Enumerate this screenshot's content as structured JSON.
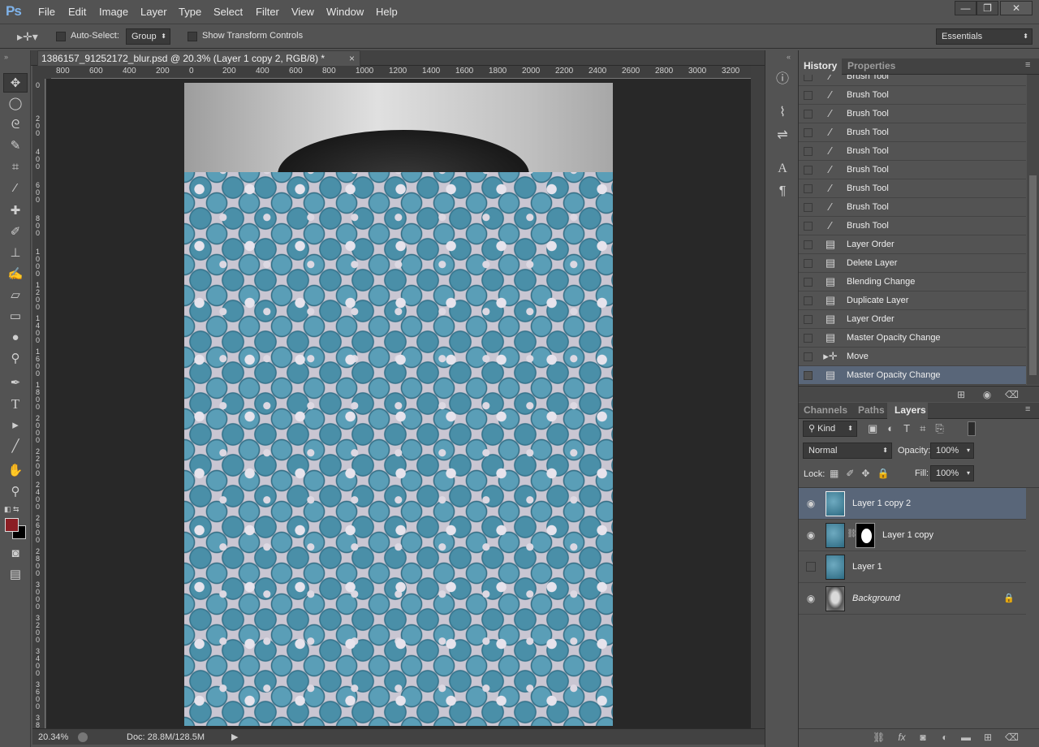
{
  "app": {
    "logo": "Ps"
  },
  "menu": [
    "File",
    "Edit",
    "Image",
    "Layer",
    "Type",
    "Select",
    "Filter",
    "View",
    "Window",
    "Help"
  ],
  "window_controls": {
    "minimize": "—",
    "restore": "❐",
    "close": "✕"
  },
  "options_bar": {
    "auto_select_label": "Auto-Select:",
    "auto_select_value": "Group",
    "transform_controls_label": "Show Transform Controls",
    "workspace": "Essentials"
  },
  "document": {
    "tab_title": "1386157_91252172_blur.psd @ 20.3% (Layer 1 copy 2, RGB/8) *",
    "close": "×"
  },
  "ruler_h": [
    "800",
    "600",
    "400",
    "200",
    "0",
    "200",
    "400",
    "600",
    "800",
    "1000",
    "1200",
    "1400",
    "1600",
    "1800",
    "2000",
    "2200",
    "2400",
    "2600",
    "2800",
    "3000",
    "3200"
  ],
  "ruler_v": [
    "0",
    "2\n0\n0",
    "4\n0\n0",
    "6\n0\n0",
    "8\n0\n0",
    "1\n0\n0\n0",
    "1\n2\n0\n0",
    "1\n4\n0\n0",
    "1\n6\n0\n0",
    "1\n8\n0\n0",
    "2\n0\n0\n0",
    "2\n2\n0\n0",
    "2\n4\n0\n0",
    "2\n6\n0\n0",
    "2\n8\n0\n0",
    "3\n0\n0\n0",
    "3\n2\n0\n0",
    "3\n4\n0\n0",
    "3\n6\n0\n0",
    "3\n8"
  ],
  "status": {
    "zoom": "20.34%",
    "doc": "Doc: 28.8M/128.5M"
  },
  "colors": {
    "foreground": "#8b1e24",
    "background": "#000000",
    "selection": "#596679"
  },
  "history_panel": {
    "tabs": [
      "History",
      "Properties"
    ],
    "items": [
      {
        "label": "Brush Tool",
        "icon": "brush-icon"
      },
      {
        "label": "Brush Tool",
        "icon": "brush-icon"
      },
      {
        "label": "Brush Tool",
        "icon": "brush-icon"
      },
      {
        "label": "Brush Tool",
        "icon": "brush-icon"
      },
      {
        "label": "Brush Tool",
        "icon": "brush-icon"
      },
      {
        "label": "Brush Tool",
        "icon": "brush-icon"
      },
      {
        "label": "Brush Tool",
        "icon": "brush-icon"
      },
      {
        "label": "Brush Tool",
        "icon": "brush-icon"
      },
      {
        "label": "Brush Tool",
        "icon": "brush-icon"
      },
      {
        "label": "Layer Order",
        "icon": "document-icon"
      },
      {
        "label": "Delete Layer",
        "icon": "document-icon"
      },
      {
        "label": "Blending Change",
        "icon": "document-icon"
      },
      {
        "label": "Duplicate Layer",
        "icon": "document-icon"
      },
      {
        "label": "Layer Order",
        "icon": "document-icon"
      },
      {
        "label": "Master Opacity Change",
        "icon": "document-icon"
      },
      {
        "label": "Move",
        "icon": "move-icon"
      },
      {
        "label": "Master Opacity Change",
        "icon": "document-icon"
      }
    ],
    "selected_index": 16
  },
  "layers_panel": {
    "tabs": [
      "Channels",
      "Paths",
      "Layers"
    ],
    "filter_kind": "Kind",
    "blend_mode": "Normal",
    "opacity_label": "Opacity:",
    "opacity": "100%",
    "lock_label": "Lock:",
    "fill_label": "Fill:",
    "fill": "100%",
    "layers": [
      {
        "name": "Layer 1 copy 2",
        "visible": true,
        "selected": true,
        "mask": false
      },
      {
        "name": "Layer 1 copy",
        "visible": true,
        "selected": false,
        "mask": true
      },
      {
        "name": "Layer 1",
        "visible": false,
        "selected": false,
        "mask": false
      },
      {
        "name": "Background",
        "visible": true,
        "selected": false,
        "mask": false,
        "locked": true
      }
    ]
  }
}
